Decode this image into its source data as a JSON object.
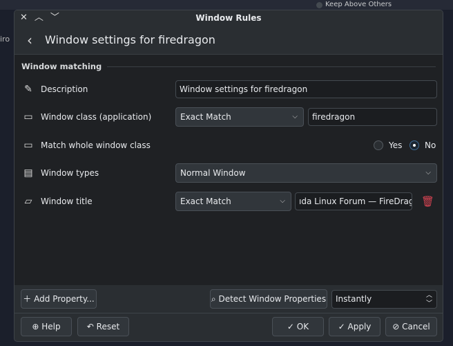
{
  "background": {
    "partial_text_left": "iro",
    "partial_text_right": "Keep Above Others"
  },
  "window": {
    "title": "Window Rules",
    "header_title": "Window settings for firedragon"
  },
  "section": {
    "title": "Window matching"
  },
  "rows": [
    {
      "icon": "pencil-icon",
      "label": "Description",
      "value": "Window settings for firedragon"
    },
    {
      "icon": "window-icon",
      "label": "Window class (application)",
      "match": "Exact Match",
      "value": "firedragon"
    },
    {
      "icon": "window-icon",
      "label": "Match whole window class",
      "options": [
        "Yes",
        "No"
      ],
      "selected": "No"
    },
    {
      "icon": "window-types-icon",
      "label": "Window types",
      "value": "Normal Window"
    },
    {
      "icon": "speech-bubble-icon",
      "label": "Window title",
      "match": "Exact Match",
      "value": "ıda Linux Forum — FireDragon"
    }
  ],
  "footer": {
    "add_property": "Add Property...",
    "detect": "Detect Window Properties",
    "delay": "Instantly",
    "help": "Help",
    "reset": "Reset",
    "ok": "OK",
    "apply": "Apply",
    "cancel": "Cancel"
  },
  "colors": {
    "delete": "#da4453",
    "radio_accent": "#3d6a94"
  }
}
